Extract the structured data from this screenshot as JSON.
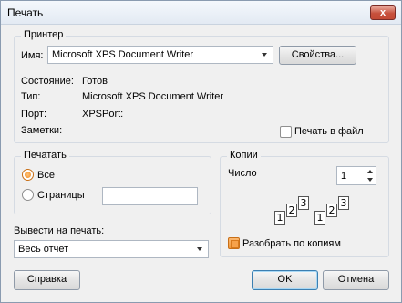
{
  "window": {
    "title": "Печать",
    "close_glyph": "x"
  },
  "printer": {
    "group_title": "Принтер",
    "name_label": "Имя:",
    "name_value": "Microsoft XPS Document Writer",
    "properties_button": "Свойства...",
    "status_label": "Состояние:",
    "status_value": "Готов",
    "type_label": "Тип:",
    "type_value": "Microsoft XPS Document Writer",
    "port_label": "Порт:",
    "port_value": "XPSPort:",
    "comment_label": "Заметки:",
    "print_to_file_label": "Печать в файл",
    "print_to_file_checked": false
  },
  "print_range": {
    "group_title": "Печатать",
    "all_label": "Все",
    "all_selected": true,
    "pages_label": "Страницы",
    "pages_value": ""
  },
  "output": {
    "label": "Вывести на печать:",
    "value": "Весь отчет"
  },
  "copies": {
    "group_title": "Копии",
    "count_label": "Число",
    "count_value": "1",
    "collate_label": "Разобрать по копиям",
    "collate_checked": true,
    "collate_icon_pages": [
      "1",
      "2",
      "3"
    ]
  },
  "buttons": {
    "help": "Справка",
    "ok": "OK",
    "cancel": "Отмена"
  },
  "icons": [
    "close-icon",
    "dropdown-arrow-icon",
    "spin-up-icon",
    "spin-down-icon",
    "collated-pages-icon"
  ]
}
